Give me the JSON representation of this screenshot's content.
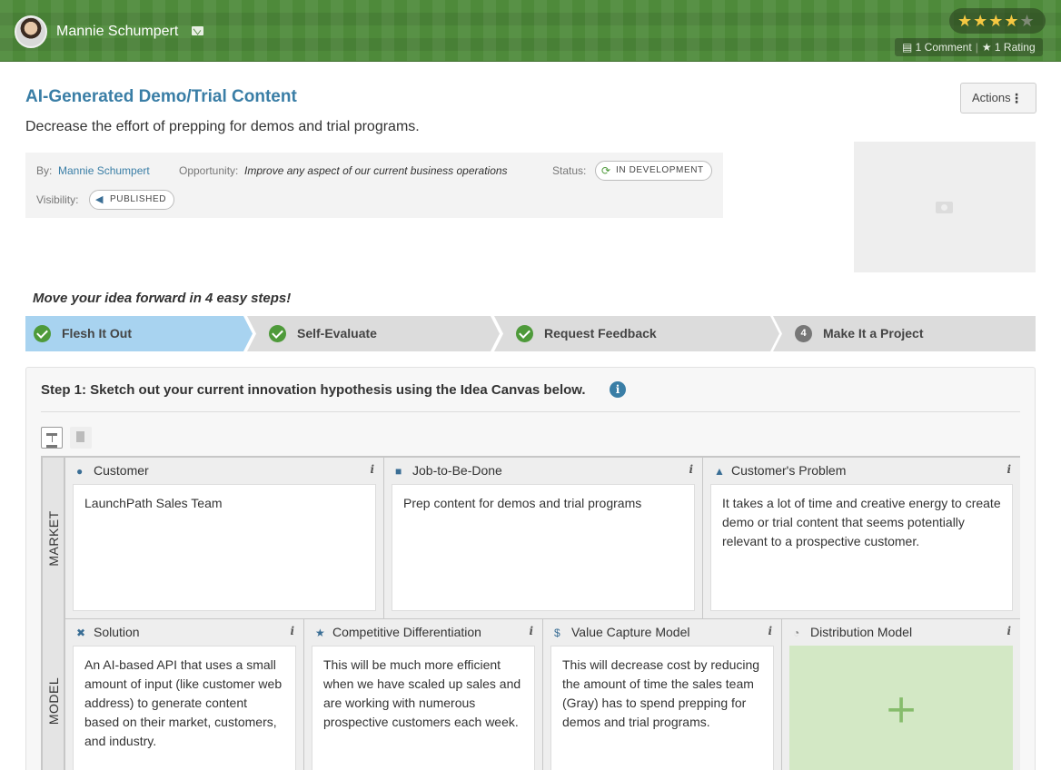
{
  "header": {
    "user_name": "Mannie Schumpert",
    "rating_stars_filled": "★★★★",
    "rating_stars_empty": "★",
    "rating_value": 4,
    "rating_max": 5,
    "comments_label": "1 Comment",
    "ratings_label": "1 Rating",
    "icons": {
      "mail": "mail-icon",
      "comment": "comment-icon",
      "star": "star-icon"
    }
  },
  "idea": {
    "title": "AI-Generated Demo/Trial Content",
    "subtitle": "Decrease the effort of prepping for demos and trial programs.",
    "actions_label": "Actions",
    "by_label": "By:",
    "by_value": "Mannie Schumpert",
    "opportunity_label": "Opportunity:",
    "opportunity_value": "Improve any aspect of our current business operations",
    "status_label": "Status:",
    "status_value": "IN DEVELOPMENT",
    "visibility_label": "Visibility:",
    "visibility_value": "PUBLISHED"
  },
  "steps": {
    "hint": "Move your idea forward in 4 easy steps!",
    "items": [
      {
        "label": "Flesh It Out",
        "state": "done"
      },
      {
        "label": "Self-Evaluate",
        "state": "done"
      },
      {
        "label": "Request Feedback",
        "state": "done"
      },
      {
        "label": "Make It a Project",
        "number": "4"
      }
    ]
  },
  "canvas": {
    "instruction": "Step 1: Sketch out your current innovation hypothesis using the Idea Canvas below.",
    "info_glyph": "i",
    "rows": [
      "MARKET",
      "MODEL"
    ],
    "market": [
      {
        "title": "Customer",
        "icon": "person-icon",
        "content": "LaunchPath Sales Team"
      },
      {
        "title": "Job-to-Be-Done",
        "icon": "briefcase-icon",
        "content": "Prep content for demos and trial programs"
      },
      {
        "title": "Customer's Problem",
        "icon": "warning-icon",
        "content": "It takes a lot of time and creative energy to create demo or trial content that seems potentially relevant to a prospective customer."
      }
    ],
    "model": [
      {
        "title": "Solution",
        "icon": "tools-icon",
        "content": "An AI-based API that uses a small amount of input (like customer web address) to generate content based on their market, customers, and industry."
      },
      {
        "title": "Competitive Differentiation",
        "icon": "star-icon",
        "content": "This will be much more efficient when we have scaled up sales and are working with numerous prospective customers each week."
      },
      {
        "title": "Value Capture Model",
        "icon": "dollar-icon",
        "content": "This will decrease cost by reducing the amount of time the sales team (Gray) has to spend prepping for demos and trial programs."
      },
      {
        "title": "Distribution Model",
        "icon": "rss-icon",
        "content": ""
      }
    ]
  },
  "colors": {
    "accent": "#3a7ea6",
    "brand_green": "#4e8a3a",
    "active_step": "#a8d3f0",
    "empty_cell": "#d3e8c5"
  }
}
